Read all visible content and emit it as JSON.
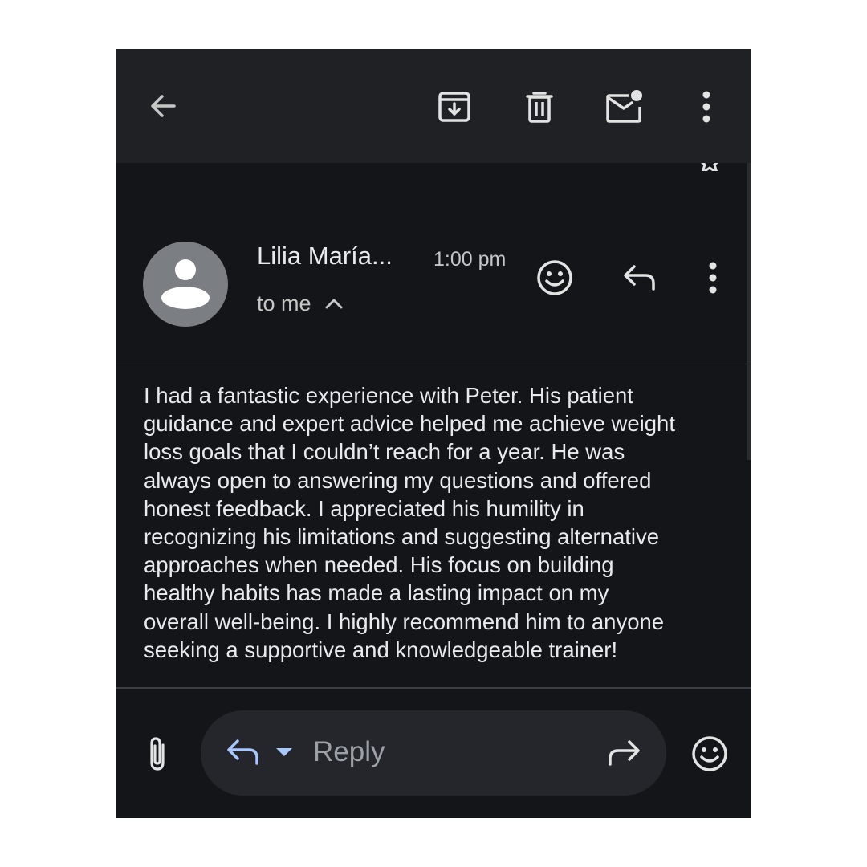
{
  "toolbar": {
    "back_icon": "arrow-left-icon",
    "archive_icon": "archive-icon",
    "delete_icon": "trash-icon",
    "mark_unread_icon": "mail-unread-icon",
    "more_icon": "more-vert-icon"
  },
  "message": {
    "sender": "Lilia María...",
    "time": "1:00 pm",
    "recipient": "to me",
    "body": "I had a fantastic experience with Peter. His patient\nguidance and expert advice helped me achieve weight\nloss goals that I couldn’t reach for a year. He was\nalways open to answering my questions and offered\nhonest feedback. I appreciated his humility in\nrecognizing his limitations and suggesting alternative\napproaches when needed. His focus on building\nhealthy habits has made a lasting impact on my\noverall well-being. I highly recommend him to anyone\nseeking a supportive and knowledgeable trainer!"
  },
  "compose": {
    "reply_label": "Reply"
  },
  "colors": {
    "background": "#141519",
    "toolbar": "#202124",
    "text": "#e8eaed",
    "muted": "#9aa0a6",
    "accent": "#a8c7fa",
    "avatar": "#7b7e83"
  }
}
